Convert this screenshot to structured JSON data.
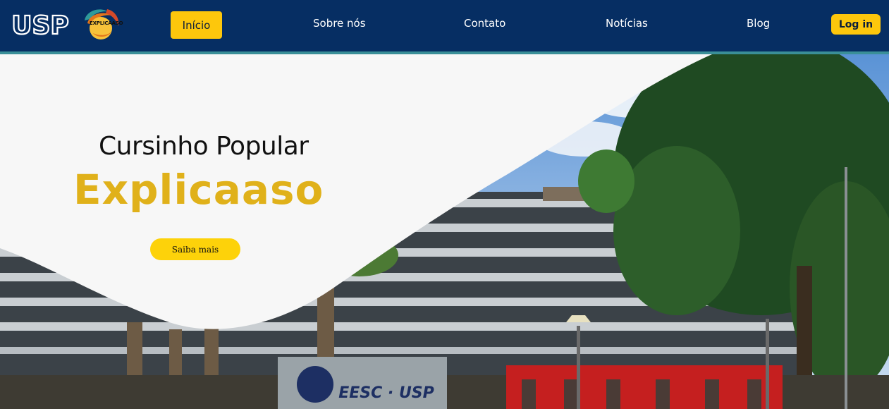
{
  "brand": {
    "usp_logo_text": "USP",
    "explicaaso_logo_text": "EXPLICAASO"
  },
  "nav": {
    "home": "Início",
    "about": "Sobre nós",
    "contact": "Contato",
    "news": "Notícias",
    "blog": "Blog",
    "login": "Log in"
  },
  "hero": {
    "subtitle": "Cursinho Popular",
    "title": "Explicaaso",
    "cta": "Saiba mais",
    "sign_text": "EESC · USP"
  },
  "colors": {
    "nav_bg": "#062e63",
    "accent_yellow": "#fdc70c",
    "title_gold": "#e0b11a",
    "nav_accent_bar": "#3a8f98"
  }
}
